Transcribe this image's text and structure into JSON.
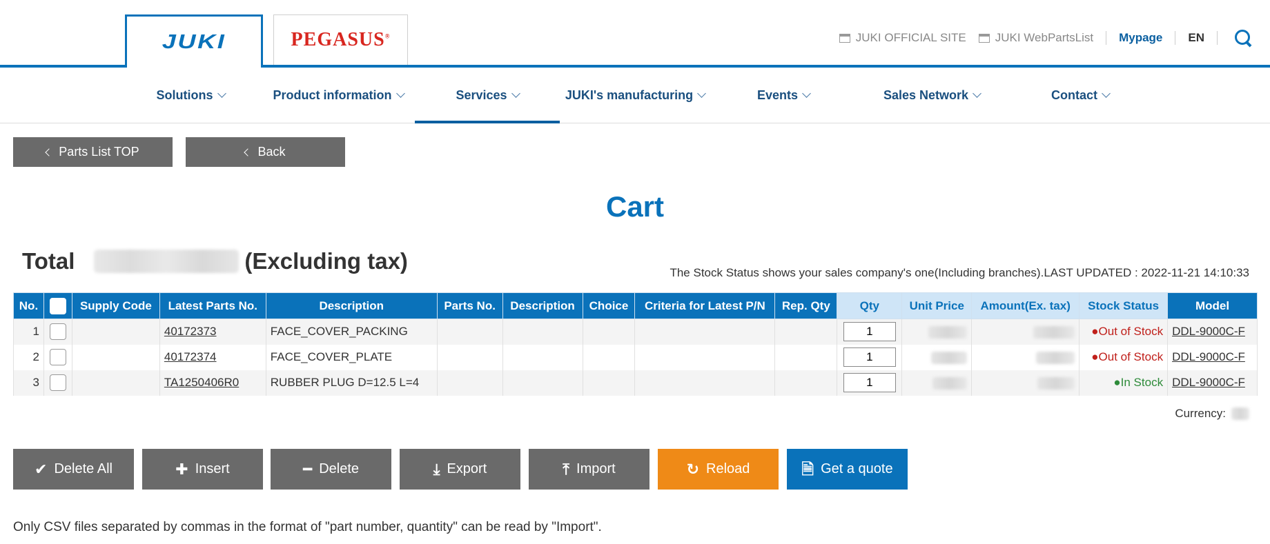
{
  "header": {
    "logo_juki": "JUKI",
    "logo_pegasus": "PEGASUS",
    "links": {
      "official_site": "JUKI OFFICIAL SITE",
      "web_parts_list": "JUKI WebPartsList",
      "mypage": "Mypage",
      "lang": "EN"
    }
  },
  "nav": {
    "items": [
      {
        "label": "Solutions"
      },
      {
        "label": "Product information"
      },
      {
        "label": "Services"
      },
      {
        "label": "JUKI's manufacturing"
      },
      {
        "label": "Events"
      },
      {
        "label": "Sales Network"
      },
      {
        "label": "Contact"
      }
    ],
    "active": "Services"
  },
  "top_buttons": {
    "parts_list_top": "Parts List TOP",
    "back": "Back"
  },
  "page_title": "Cart",
  "total": {
    "label": "Total",
    "suffix": "(Excluding tax)"
  },
  "stock_note": "The Stock Status shows your sales company's one(Including branches).LAST UPDATED : 2022-11-21 14:10:33",
  "table": {
    "headers": [
      "No.",
      "",
      "Supply Code",
      "Latest Parts No.",
      "Description",
      "Parts No.",
      "Description",
      "Choice",
      "Criteria for Latest P/N",
      "Rep. Qty",
      "Qty",
      "Unit Price",
      "Amount(Ex. tax)",
      "Stock Status",
      "Model"
    ],
    "rows": [
      {
        "no": "1",
        "supply_code": "",
        "latest_parts_no": "40172373",
        "description": "FACE_COVER_PACKING",
        "parts_no": "",
        "description2": "",
        "choice": "",
        "criteria": "",
        "rep_qty": "",
        "qty": "1",
        "stock_status": "●Out of Stock",
        "model": "DDL-9000C-F"
      },
      {
        "no": "2",
        "supply_code": "",
        "latest_parts_no": "40172374",
        "description": "FACE_COVER_PLATE",
        "parts_no": "",
        "description2": "",
        "choice": "",
        "criteria": "",
        "rep_qty": "",
        "qty": "1",
        "stock_status": "●Out of Stock",
        "model": "DDL-9000C-F"
      },
      {
        "no": "3",
        "supply_code": "",
        "latest_parts_no": "TA1250406R0",
        "description": "RUBBER PLUG D=12.5 L=4",
        "parts_no": "",
        "description2": "",
        "choice": "",
        "criteria": "",
        "rep_qty": "",
        "qty": "1",
        "stock_status": "●In Stock",
        "model": "DDL-9000C-F"
      }
    ]
  },
  "currency_label": "Currency:",
  "actions": {
    "delete_all": "Delete All",
    "insert": "Insert",
    "delete": "Delete",
    "export": "Export",
    "import": "Import",
    "reload": "Reload",
    "get_quote": "Get a quote"
  },
  "csv_note": "Only CSV files separated by commas in the format of \"part number, quantity\" can be read by \"Import\".",
  "colors": {
    "brand_blue": "#0a72ba",
    "button_gray": "#6a6a6a",
    "reload_orange": "#ef8a17",
    "out_of_stock": "#c0201b",
    "in_stock": "#2e8b3a"
  }
}
